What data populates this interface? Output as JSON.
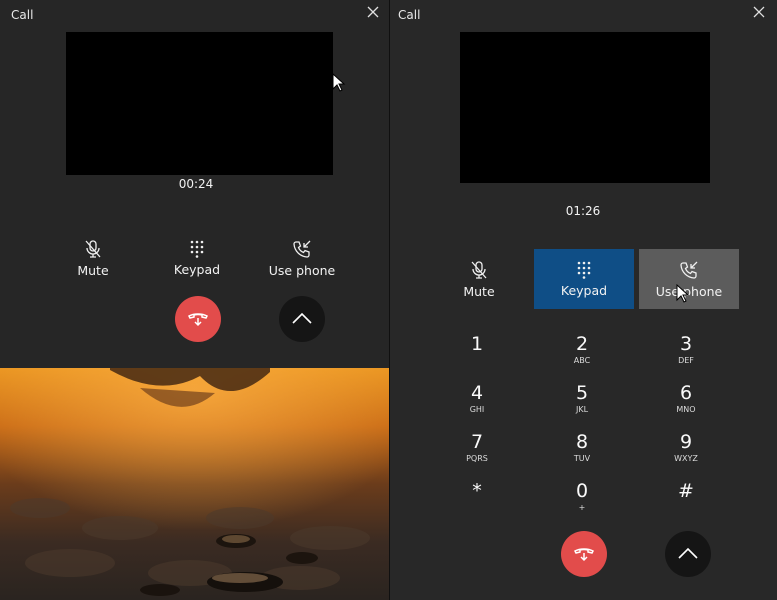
{
  "left_window": {
    "title": "Call",
    "timer": "00:24",
    "controls": {
      "mute": "Mute",
      "keypad": "Keypad",
      "use_phone": "Use phone"
    }
  },
  "right_window": {
    "title": "Call",
    "timer": "01:26",
    "controls": {
      "mute": "Mute",
      "keypad": "Keypad",
      "use_phone": "Use phone"
    },
    "keypad": [
      {
        "digit": "1",
        "letters": ""
      },
      {
        "digit": "2",
        "letters": "ABC"
      },
      {
        "digit": "3",
        "letters": "DEF"
      },
      {
        "digit": "4",
        "letters": "GHI"
      },
      {
        "digit": "5",
        "letters": "JKL"
      },
      {
        "digit": "6",
        "letters": "MNO"
      },
      {
        "digit": "7",
        "letters": "PQRS"
      },
      {
        "digit": "8",
        "letters": "TUV"
      },
      {
        "digit": "9",
        "letters": "WXYZ"
      },
      {
        "digit": "*",
        "letters": ""
      },
      {
        "digit": "0",
        "letters": "+"
      },
      {
        "digit": "#",
        "letters": ""
      }
    ]
  },
  "icons": {
    "close": "close-icon",
    "mute": "microphone-muted-icon",
    "keypad": "dialpad-icon",
    "use_phone": "phone-transfer-icon",
    "hangup": "hang-up-icon",
    "expand": "chevron-up-icon"
  },
  "colors": {
    "hangup": "#e24c4b",
    "keypad_active": "#0f4e86",
    "use_phone_hover": "#5c5c5c"
  }
}
